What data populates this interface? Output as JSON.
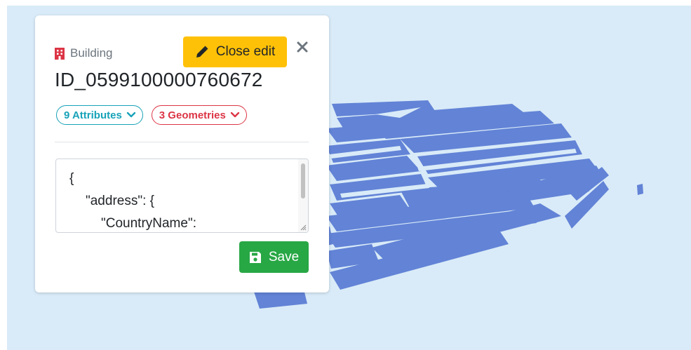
{
  "feature_panel": {
    "type_label": "Building",
    "id_title": "ID_0599100000760672",
    "close_edit_label": "Close edit",
    "attributes_badge": "9 Attributes",
    "geometries_badge": "3 Geometries",
    "editor_lines": [
      "{",
      "\"address\": {",
      "\"CountryName\":"
    ],
    "save_label": "Save"
  },
  "icons": {
    "type": "building-icon",
    "close_edit": "pencil-icon",
    "close": "close-icon",
    "badge_toggle": "chevron-down-icon",
    "save": "floppy-disk-icon"
  },
  "colors": {
    "viewport_bg": "#d9ebf8",
    "buildings": "#6283d6",
    "warning": "#ffc107",
    "info": "#17a2b8",
    "danger": "#dc3545",
    "success": "#28a745"
  }
}
